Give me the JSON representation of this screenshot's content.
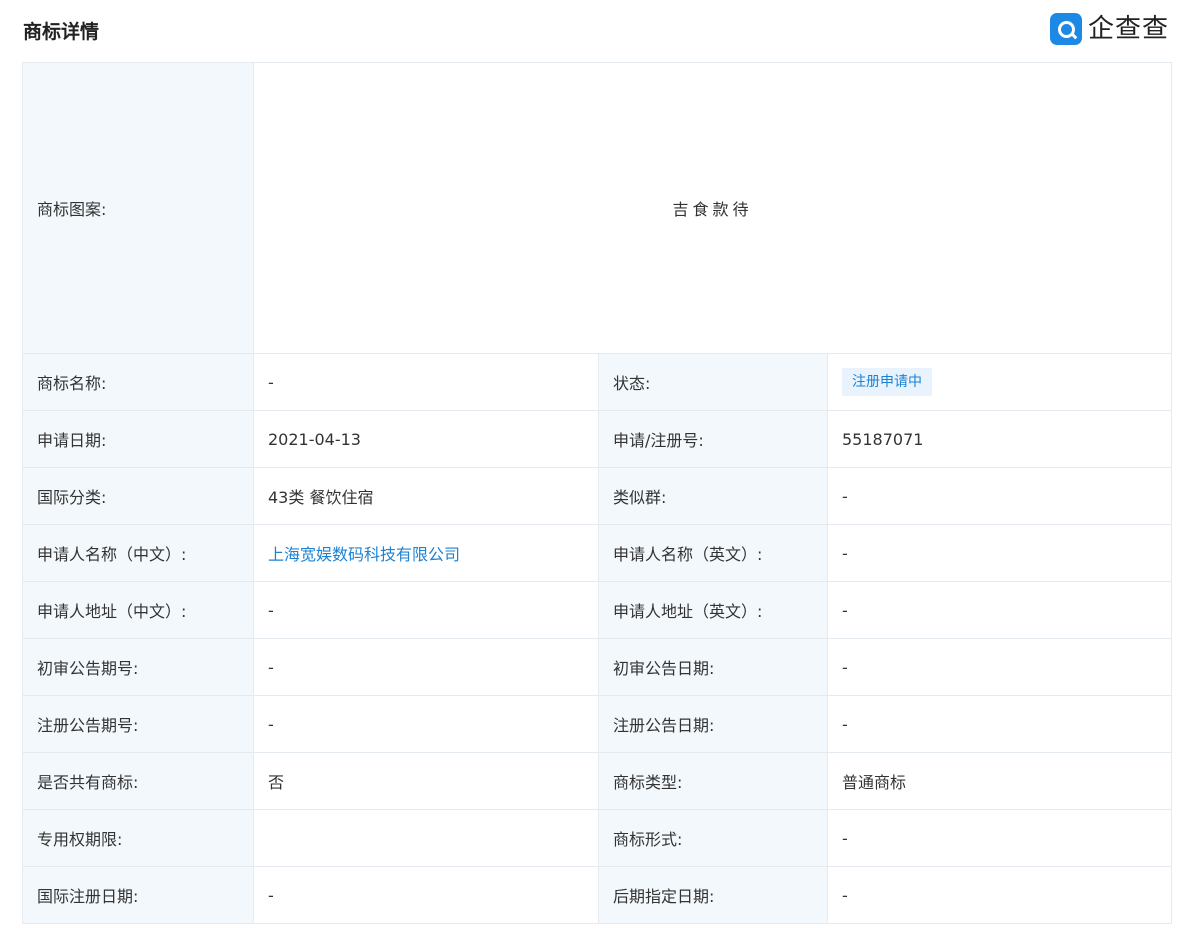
{
  "header": {
    "title": "商标详情",
    "logo_text": "企查查",
    "logo_icon": "qichacha-logo-icon"
  },
  "trademark_image": {
    "label": "商标图案:",
    "text": "吉食款待"
  },
  "rows": [
    {
      "l1": "商标名称:",
      "v1": "-",
      "l2": "状态:",
      "v2": "注册申请中"
    },
    {
      "l1": "申请日期:",
      "v1": "2021-04-13",
      "l2": "申请/注册号:",
      "v2": "55187071"
    },
    {
      "l1": "国际分类:",
      "v1": "43类 餐饮住宿",
      "l2": "类似群:",
      "v2": "-"
    },
    {
      "l1": "申请人名称（中文）:",
      "v1": "上海宽娱数码科技有限公司",
      "l2": "申请人名称（英文）:",
      "v2": "-"
    },
    {
      "l1": "申请人地址（中文）:",
      "v1": "-",
      "l2": "申请人地址（英文）:",
      "v2": "-"
    },
    {
      "l1": "初审公告期号:",
      "v1": "-",
      "l2": "初审公告日期:",
      "v2": "-"
    },
    {
      "l1": "注册公告期号:",
      "v1": "-",
      "l2": "注册公告日期:",
      "v2": "-"
    },
    {
      "l1": "是否共有商标:",
      "v1": "否",
      "l2": "商标类型:",
      "v2": "普通商标"
    },
    {
      "l1": "专用权期限:",
      "v1": "",
      "l2": "商标形式:",
      "v2": "-"
    },
    {
      "l1": "国际注册日期:",
      "v1": "-",
      "l2": "后期指定日期:",
      "v2": "-"
    }
  ],
  "colors": {
    "label_bg": "#f2f8fc",
    "border": "#e5e9f0",
    "link": "#1e82d2",
    "badge_bg": "#e8f3fd",
    "logo_blue": "#1e88e5"
  }
}
